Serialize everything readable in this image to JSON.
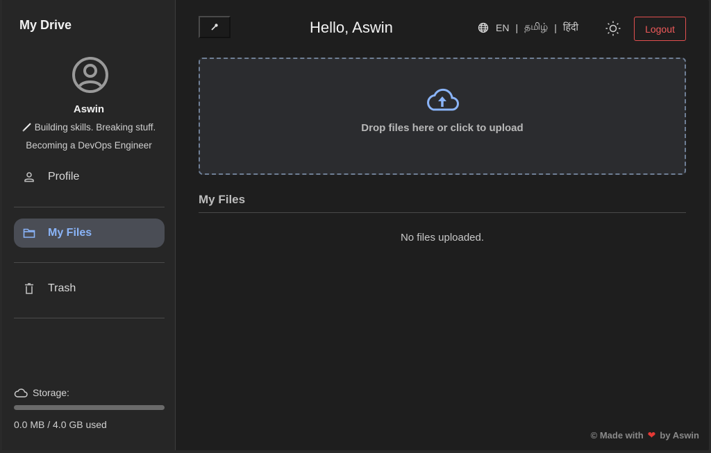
{
  "sidebar": {
    "brand": "My Drive",
    "user": {
      "name": "Aswin",
      "bio_line1": "Building skills. Breaking stuff.",
      "bio_line2": "Becoming a DevOps Engineer"
    },
    "nav": [
      {
        "label": "Profile",
        "icon": "person-icon",
        "active": false
      },
      {
        "label": "My Files",
        "icon": "folder-icon",
        "active": true
      },
      {
        "label": "Trash",
        "icon": "trash-icon",
        "active": false
      }
    ],
    "storage": {
      "label": "Storage:",
      "used_text": "0.0 MB / 4.0 GB used",
      "used_fraction": 0.0
    }
  },
  "header": {
    "greeting": "Hello, Aswin",
    "languages": [
      "EN",
      "தமிழ்",
      "हिंदी"
    ],
    "logout_label": "Logout"
  },
  "upload": {
    "prompt": "Drop files here or click to upload"
  },
  "files": {
    "title": "My Files",
    "empty_message": "No files uploaded."
  },
  "footer": {
    "prefix": "© Made with",
    "suffix": "by Aswin"
  },
  "colors": {
    "accent": "#8ab4f8",
    "danger": "#e35050",
    "background": "#1e1e1e",
    "sidebar": "#262626"
  }
}
